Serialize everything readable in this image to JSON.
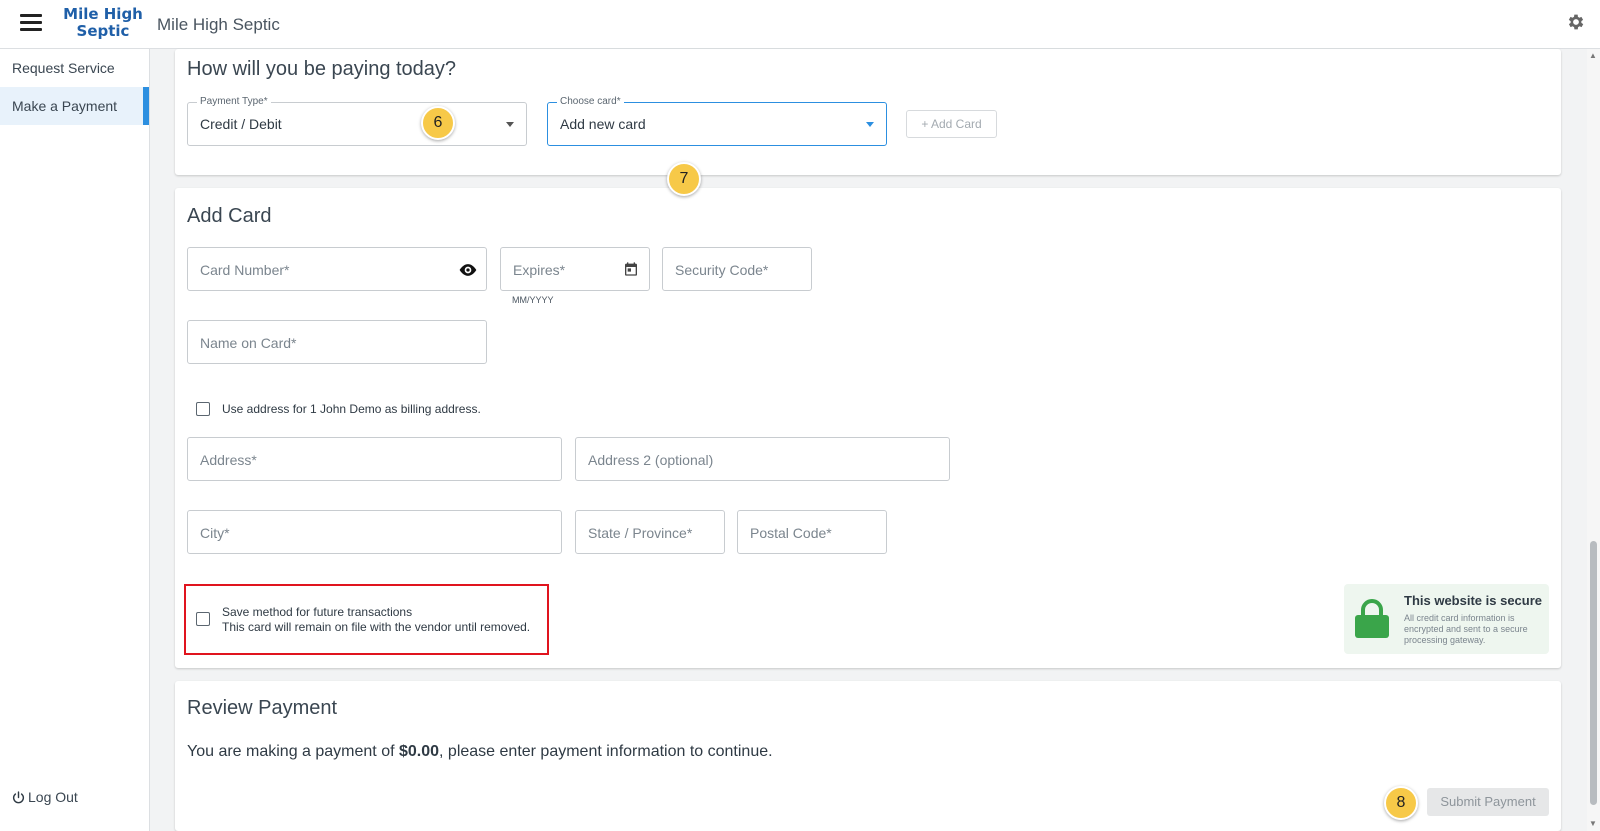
{
  "app": {
    "logo_line1": "Mile High",
    "logo_line2": "Septic",
    "title": "Mile High Septic"
  },
  "sidebar": {
    "items": [
      {
        "label": "Request Service",
        "active": false
      },
      {
        "label": "Make a Payment",
        "active": true
      }
    ],
    "logout_label": "Log Out"
  },
  "payment_method": {
    "heading": "How will you be paying today?",
    "payment_type": {
      "label": "Payment Type*",
      "value": "Credit / Debit"
    },
    "choose_card": {
      "label": "Choose card*",
      "value": "Add new card"
    },
    "add_card_button": "+ Add Card"
  },
  "add_card": {
    "heading": "Add Card",
    "card_number_placeholder": "Card Number*",
    "expires_placeholder": "Expires*",
    "expires_hint": "MM/YYYY",
    "security_code_placeholder": "Security Code*",
    "name_on_card_placeholder": "Name on Card*",
    "use_address_label": "Use address for 1 John Demo as billing address.",
    "address_placeholder": "Address*",
    "address2_placeholder": "Address 2 (optional)",
    "city_placeholder": "City*",
    "state_placeholder": "State / Province*",
    "postal_placeholder": "Postal Code*",
    "save_method_line1": "Save method for future transactions",
    "save_method_line2": "This card will remain on file with the vendor until removed.",
    "secure_title": "This website is secure",
    "secure_desc": "All credit card information is encrypted and sent to a secure processing gateway."
  },
  "review": {
    "heading": "Review Payment",
    "text_before": "You are making a payment of ",
    "amount": "$0.00",
    "text_after": ", please enter payment information to continue.",
    "submit_label": "Submit Payment"
  },
  "step_badges": {
    "payment_type": "6",
    "choose_card": "7",
    "submit": "8"
  },
  "colors": {
    "accent": "#2c8fe0",
    "highlight_box": "#e0141e",
    "badge": "#f7c948",
    "secure_lock": "#3aa54a"
  }
}
